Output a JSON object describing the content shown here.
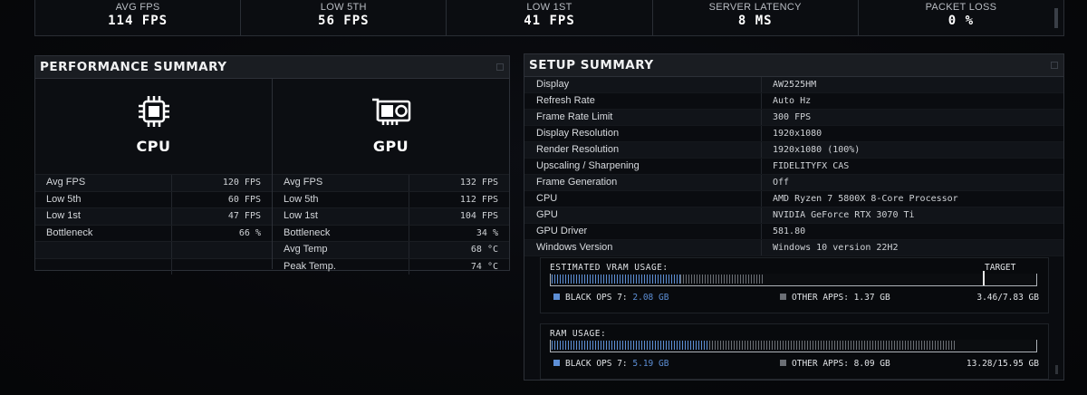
{
  "top_stats": [
    {
      "label": "AVG FPS",
      "value": "114 FPS"
    },
    {
      "label": "LOW 5TH",
      "value": "56 FPS"
    },
    {
      "label": "LOW 1ST",
      "value": "41 FPS"
    },
    {
      "label": "SERVER LATENCY",
      "value": "8 MS"
    },
    {
      "label": "PACKET LOSS",
      "value": "0 %"
    }
  ],
  "performance": {
    "title": "PERFORMANCE SUMMARY",
    "cpu": {
      "name": "CPU",
      "rows": [
        {
          "k": "Avg FPS",
          "v": "120 FPS"
        },
        {
          "k": "Low 5th",
          "v": "60 FPS"
        },
        {
          "k": "Low 1st",
          "v": "47 FPS"
        },
        {
          "k": "Bottleneck",
          "v": "66 %"
        },
        {
          "k": "",
          "v": ""
        },
        {
          "k": "",
          "v": ""
        }
      ]
    },
    "gpu": {
      "name": "GPU",
      "rows": [
        {
          "k": "Avg FPS",
          "v": "132 FPS"
        },
        {
          "k": "Low 5th",
          "v": "112 FPS"
        },
        {
          "k": "Low 1st",
          "v": "104 FPS"
        },
        {
          "k": "Bottleneck",
          "v": "34 %"
        },
        {
          "k": "Avg Temp",
          "v": "68 °C"
        },
        {
          "k": "Peak Temp.",
          "v": "74 °C"
        }
      ]
    }
  },
  "setup": {
    "title": "SETUP SUMMARY",
    "rows": [
      {
        "k": "Display",
        "v": "AW2525HM"
      },
      {
        "k": "Refresh Rate",
        "v": "Auto Hz"
      },
      {
        "k": "Frame Rate Limit",
        "v": "300 FPS"
      },
      {
        "k": "Display Resolution",
        "v": "1920x1080"
      },
      {
        "k": "Render Resolution",
        "v": "1920x1080 (100%)"
      },
      {
        "k": "Upscaling / Sharpening",
        "v": "FIDELITYFX CAS"
      },
      {
        "k": "Frame Generation",
        "v": "Off"
      },
      {
        "k": "CPU",
        "v": "AMD Ryzen 7 5800X 8-Core Processor"
      },
      {
        "k": "GPU",
        "v": "NVIDIA GeForce RTX 3070 Ti"
      },
      {
        "k": "GPU Driver",
        "v": "581.80"
      },
      {
        "k": "Windows Version",
        "v": "Windows 10 version 22H2"
      }
    ],
    "vram": {
      "title": "ESTIMATED VRAM USAGE:",
      "target_label": "TARGET",
      "game_label": "BLACK OPS 7:",
      "game_value": "2.08 GB",
      "other_label": "OTHER APPS:",
      "other_value": "1.37 GB",
      "total": "3.46/7.83 GB",
      "game_fraction": 0.266,
      "other_fraction": 0.175,
      "target_fraction": 0.893
    },
    "ram": {
      "title": "RAM USAGE:",
      "game_label": "BLACK OPS 7:",
      "game_value": "5.19 GB",
      "other_label": "OTHER APPS:",
      "other_value": "8.09 GB",
      "total": "13.28/15.95 GB",
      "game_fraction": 0.325,
      "other_fraction": 0.507
    }
  },
  "colors": {
    "game": "#5d8fd6",
    "other": "#6b6f75"
  }
}
